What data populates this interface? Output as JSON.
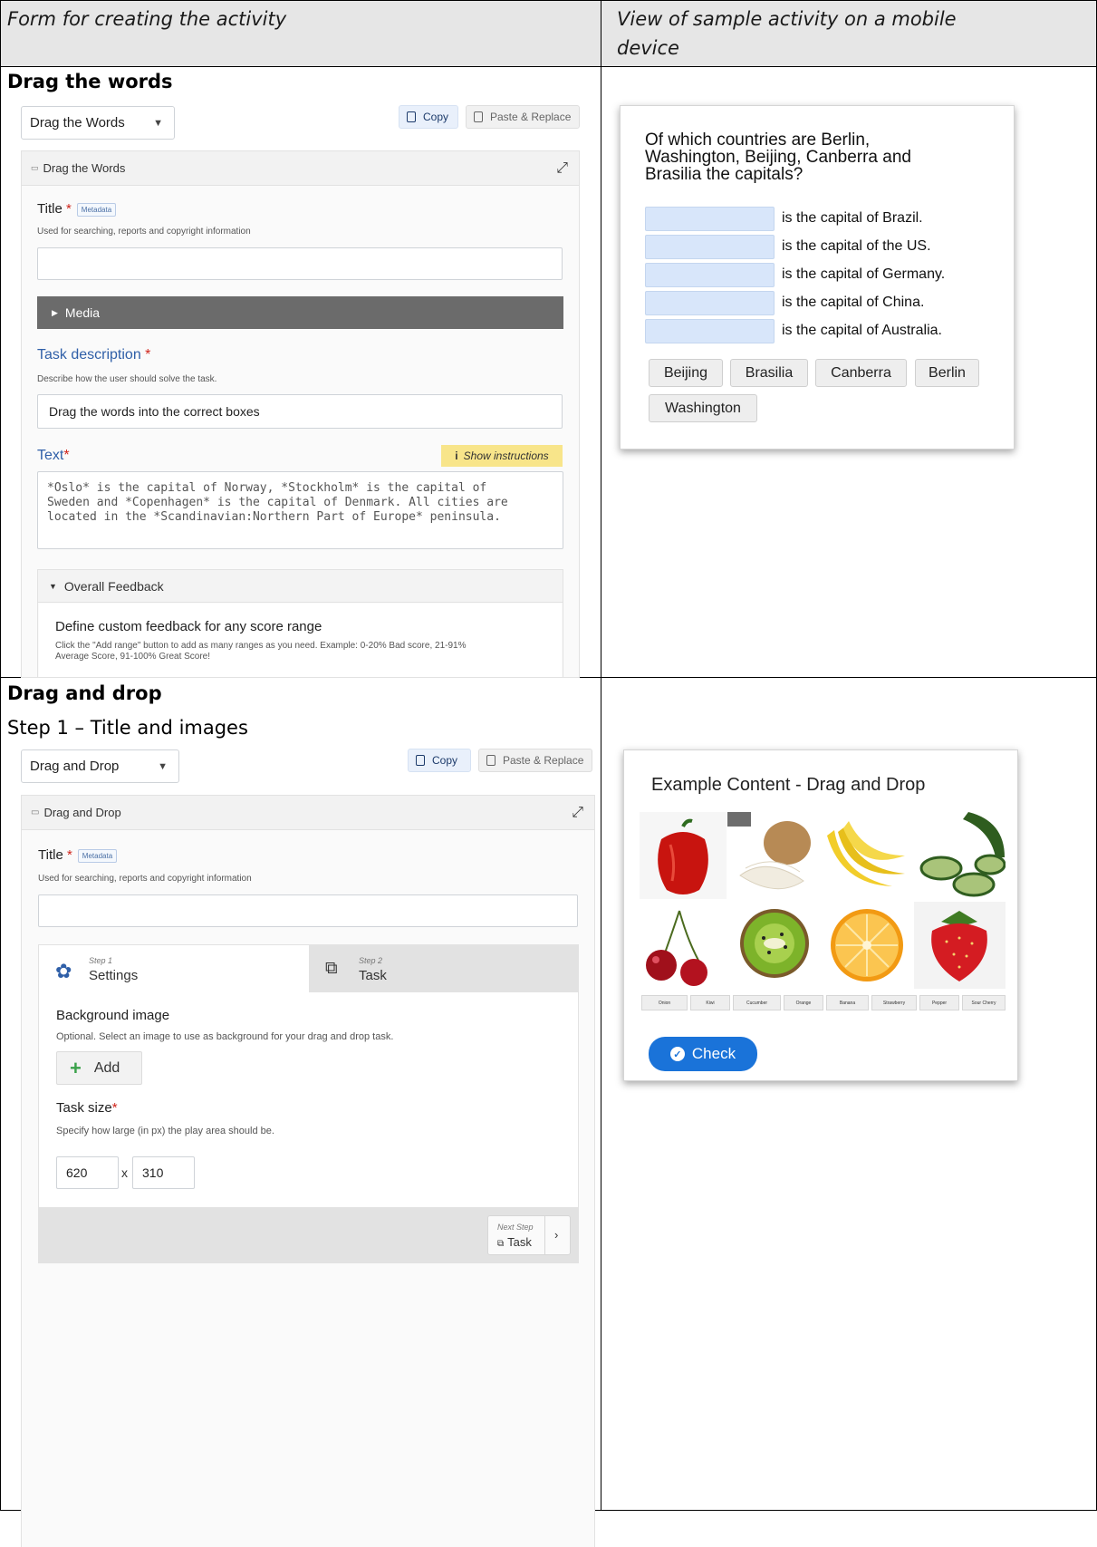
{
  "header": {
    "left": "Form for creating the activity",
    "right_line1": "View of sample activity on a mobile",
    "right_line2": "device"
  },
  "section1": {
    "title": "Drag the words",
    "editor": {
      "content_type": "Drag the Words",
      "copy_label": "Copy",
      "paste_label": "Paste & Replace",
      "panel_title": "Drag the Words",
      "title_label": "Title",
      "metadata_label": "Metadata",
      "title_desc": "Used for searching, reports and copyright information",
      "title_value": "",
      "media_label": "Media",
      "task_desc_label": "Task description",
      "task_desc_help": "Describe how the user should solve the task.",
      "task_desc_value": "Drag the words into the correct boxes",
      "text_label": "Text",
      "instructions_label": "Show instructions",
      "text_value": "*Oslo* is the capital of Norway, *Stockholm* is the capital of\nSweden and *Copenhagen* is the capital of Denmark. All cities are\nlocated in the *Scandinavian:Northern Part of Europe* peninsula.",
      "feedback_label": "Overall Feedback",
      "feedback_title": "Define custom feedback for any score range",
      "feedback_help_1": "Click the \"Add range\" button to add as many ranges as you need. Example: 0-20% Bad score, 21-91%",
      "feedback_help_2": "Average Score, 91-100% Great Score!"
    },
    "preview": {
      "question_1": "Of which countries are Berlin,",
      "question_2": "Washington, Beijing, Canberra and",
      "question_3": "Brasilia the capitals?",
      "sentences": [
        "is the capital of Brazil.",
        "is the capital of the US.",
        "is the capital of Germany.",
        "is the capital of China.",
        "is the capital of Australia."
      ],
      "words": [
        "Beijing",
        "Brasilia",
        "Canberra",
        "Berlin",
        "Washington"
      ]
    }
  },
  "section2": {
    "title": "Drag and drop",
    "subtitle": "Step 1 – Title and images",
    "editor": {
      "content_type": "Drag and Drop",
      "copy_label": "Copy",
      "paste_label": "Paste & Replace",
      "panel_title": "Drag and Drop",
      "title_label": "Title",
      "metadata_label": "Metadata",
      "title_desc": "Used for searching, reports and copyright information",
      "step1_small": "Step 1",
      "step1_label": "Settings",
      "step2_small": "Step 2",
      "step2_label": "Task",
      "bg_label": "Background image",
      "bg_desc": "Optional. Select an image to use as background for your drag and drop task.",
      "add_label": "Add",
      "size_label": "Task size",
      "size_desc": "Specify how large (in px) the play area should be.",
      "width_value": "620",
      "times": "x",
      "height_value": "310",
      "next_small": "Next Step",
      "next_label": "Task"
    },
    "preview": {
      "title": "Example Content - Drag and Drop",
      "labels": [
        "Onion",
        "Kiwi",
        "Cucumber",
        "Orange",
        "Banana",
        "Strawberry",
        "Pepper",
        "Sour Cherry"
      ],
      "check_label": "Check"
    }
  },
  "colors": {
    "accent_blue": "#1a73d9",
    "slot_blue": "#d8e6fa",
    "media_bar": "#6b6b6b",
    "instructions": "#f8e58a"
  },
  "icons": [
    "chevron-down-icon",
    "copy-icon",
    "paste-icon",
    "expand-icon",
    "info-icon",
    "gear-icon",
    "task-icon",
    "plus-icon",
    "check-circle-icon",
    "chevron-right-icon"
  ]
}
